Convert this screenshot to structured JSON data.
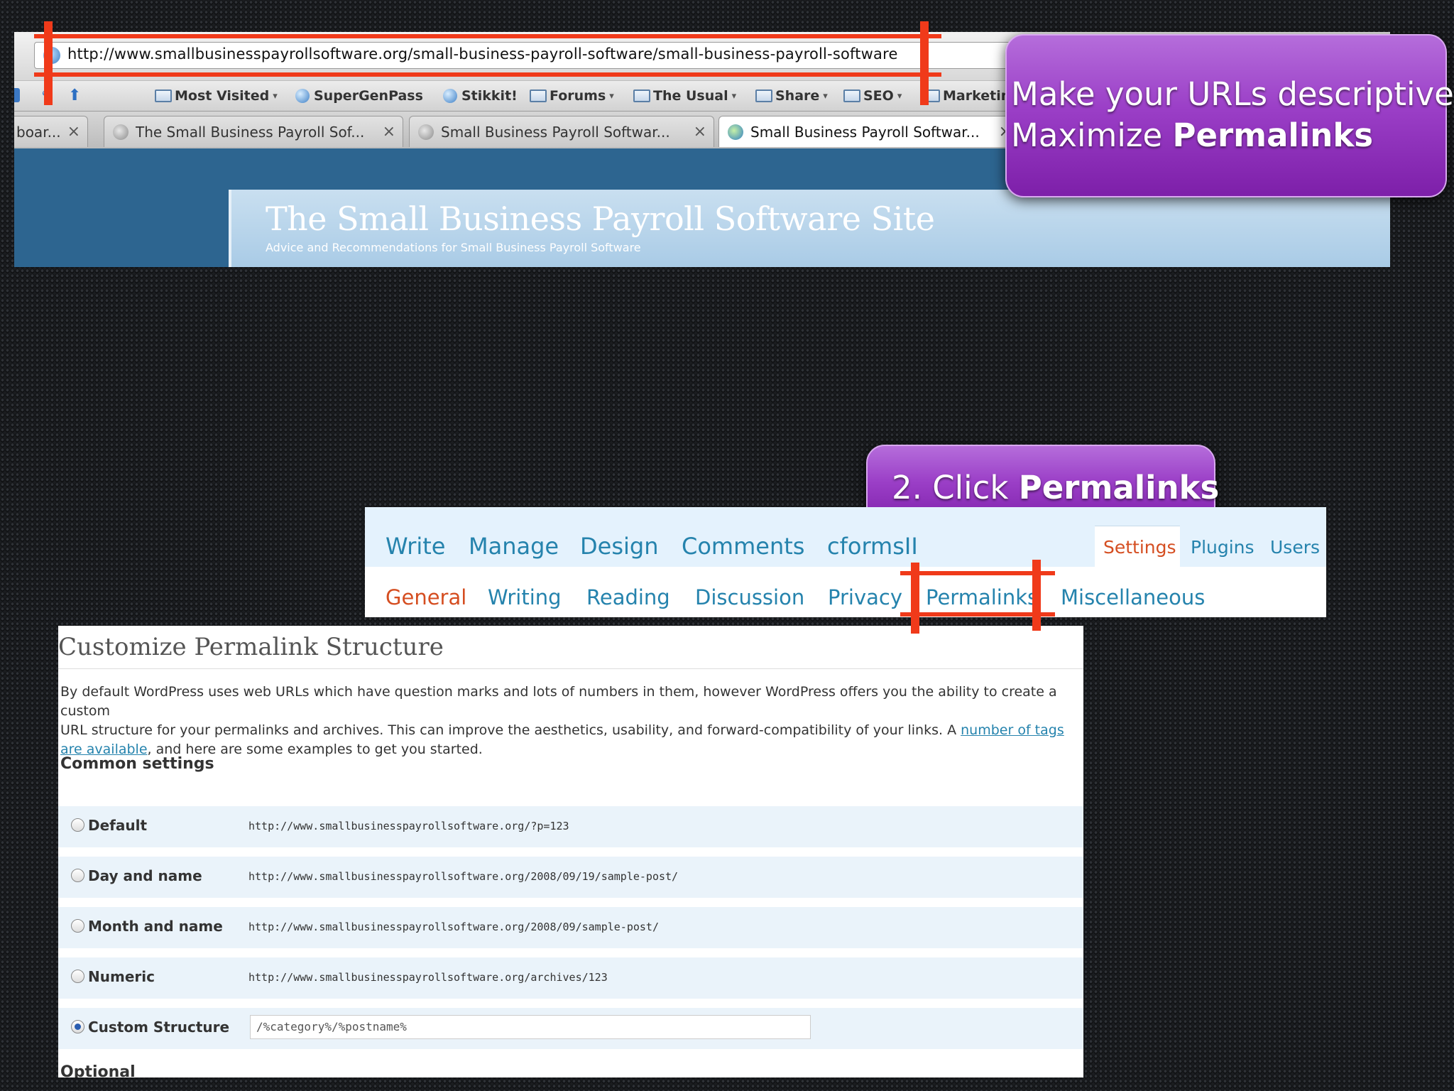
{
  "browser": {
    "url": "http://www.smallbusinesspayrollsoftware.org/small-business-payroll-software/small-business-payroll-software",
    "bookmarks": [
      {
        "label": "Most Visited",
        "kind": "folder",
        "has_menu": true
      },
      {
        "label": "SuperGenPass",
        "kind": "globe",
        "has_menu": false
      },
      {
        "label": "Stikkit!",
        "kind": "globe",
        "has_menu": false
      },
      {
        "label": "Forums",
        "kind": "folder",
        "has_menu": true
      },
      {
        "label": "The Usual",
        "kind": "folder",
        "has_menu": true
      },
      {
        "label": "Share",
        "kind": "folder",
        "has_menu": true
      },
      {
        "label": "SEO",
        "kind": "folder",
        "has_menu": true
      },
      {
        "label": "Marketing",
        "kind": "folder",
        "has_menu": false
      }
    ],
    "menu_arrow": "▾",
    "tabs": [
      {
        "label": "boar...",
        "active": false
      },
      {
        "label": "The Small Business Payroll Sof...",
        "active": false
      },
      {
        "label": "Small Business Payroll Softwar...",
        "active": false
      },
      {
        "label": "Small Business Payroll Softwar...",
        "active": true
      }
    ],
    "tab_close": "×"
  },
  "site": {
    "title": "The Small Business Payroll Software Site",
    "tagline": "Advice and Recommendations for Small Business Payroll Software"
  },
  "callouts": {
    "top": {
      "line1": "Make your URLs descriptive.",
      "line2_prefix": "Maximize ",
      "line2_bold": "Permalinks"
    },
    "mid": {
      "prefix": "2. Click ",
      "bold": "Permalinks"
    }
  },
  "wp_nav": {
    "main": [
      "Write",
      "Manage",
      "Design",
      "Comments",
      "cformsII"
    ],
    "right": [
      "Settings",
      "Plugins",
      "Users"
    ],
    "sub": [
      "General",
      "Writing",
      "Reading",
      "Discussion",
      "Privacy",
      "Permalinks",
      "Miscellaneous"
    ],
    "current_right": "Settings",
    "current_sub": "General"
  },
  "permalinks": {
    "title": "Customize Permalink Structure",
    "intro_line1": "By default WordPress uses web URLs which have question marks and lots of numbers in them, however WordPress offers you the ability to create a custom",
    "intro_line2": "URL structure for your permalinks and archives. This can improve the aesthetics, usability, and forward-compatibility of your links. A ",
    "intro_link": "number of tags are available",
    "intro_end": ", and here are some examples to get you started.",
    "common_settings": "Common settings",
    "options": [
      {
        "label": "Default",
        "url": "http://www.smallbusinesspayrollsoftware.org/?p=123",
        "checked": false
      },
      {
        "label": "Day and name",
        "url": "http://www.smallbusinesspayrollsoftware.org/2008/09/19/sample-post/",
        "checked": false
      },
      {
        "label": "Month and name",
        "url": "http://www.smallbusinesspayrollsoftware.org/2008/09/sample-post/",
        "checked": false
      },
      {
        "label": "Numeric",
        "url": "http://www.smallbusinesspayrollsoftware.org/archives/123",
        "checked": false
      },
      {
        "label": "Custom Structure",
        "url": "",
        "checked": true
      }
    ],
    "custom_value": "/%category%/%postname%",
    "optional": "Optional"
  },
  "colors": {
    "highlight": "#f03a1a",
    "callout": "#9b3fc7",
    "wp_link": "#2583ad",
    "wp_current": "#d54e21",
    "browser_content": "#2d6590"
  }
}
